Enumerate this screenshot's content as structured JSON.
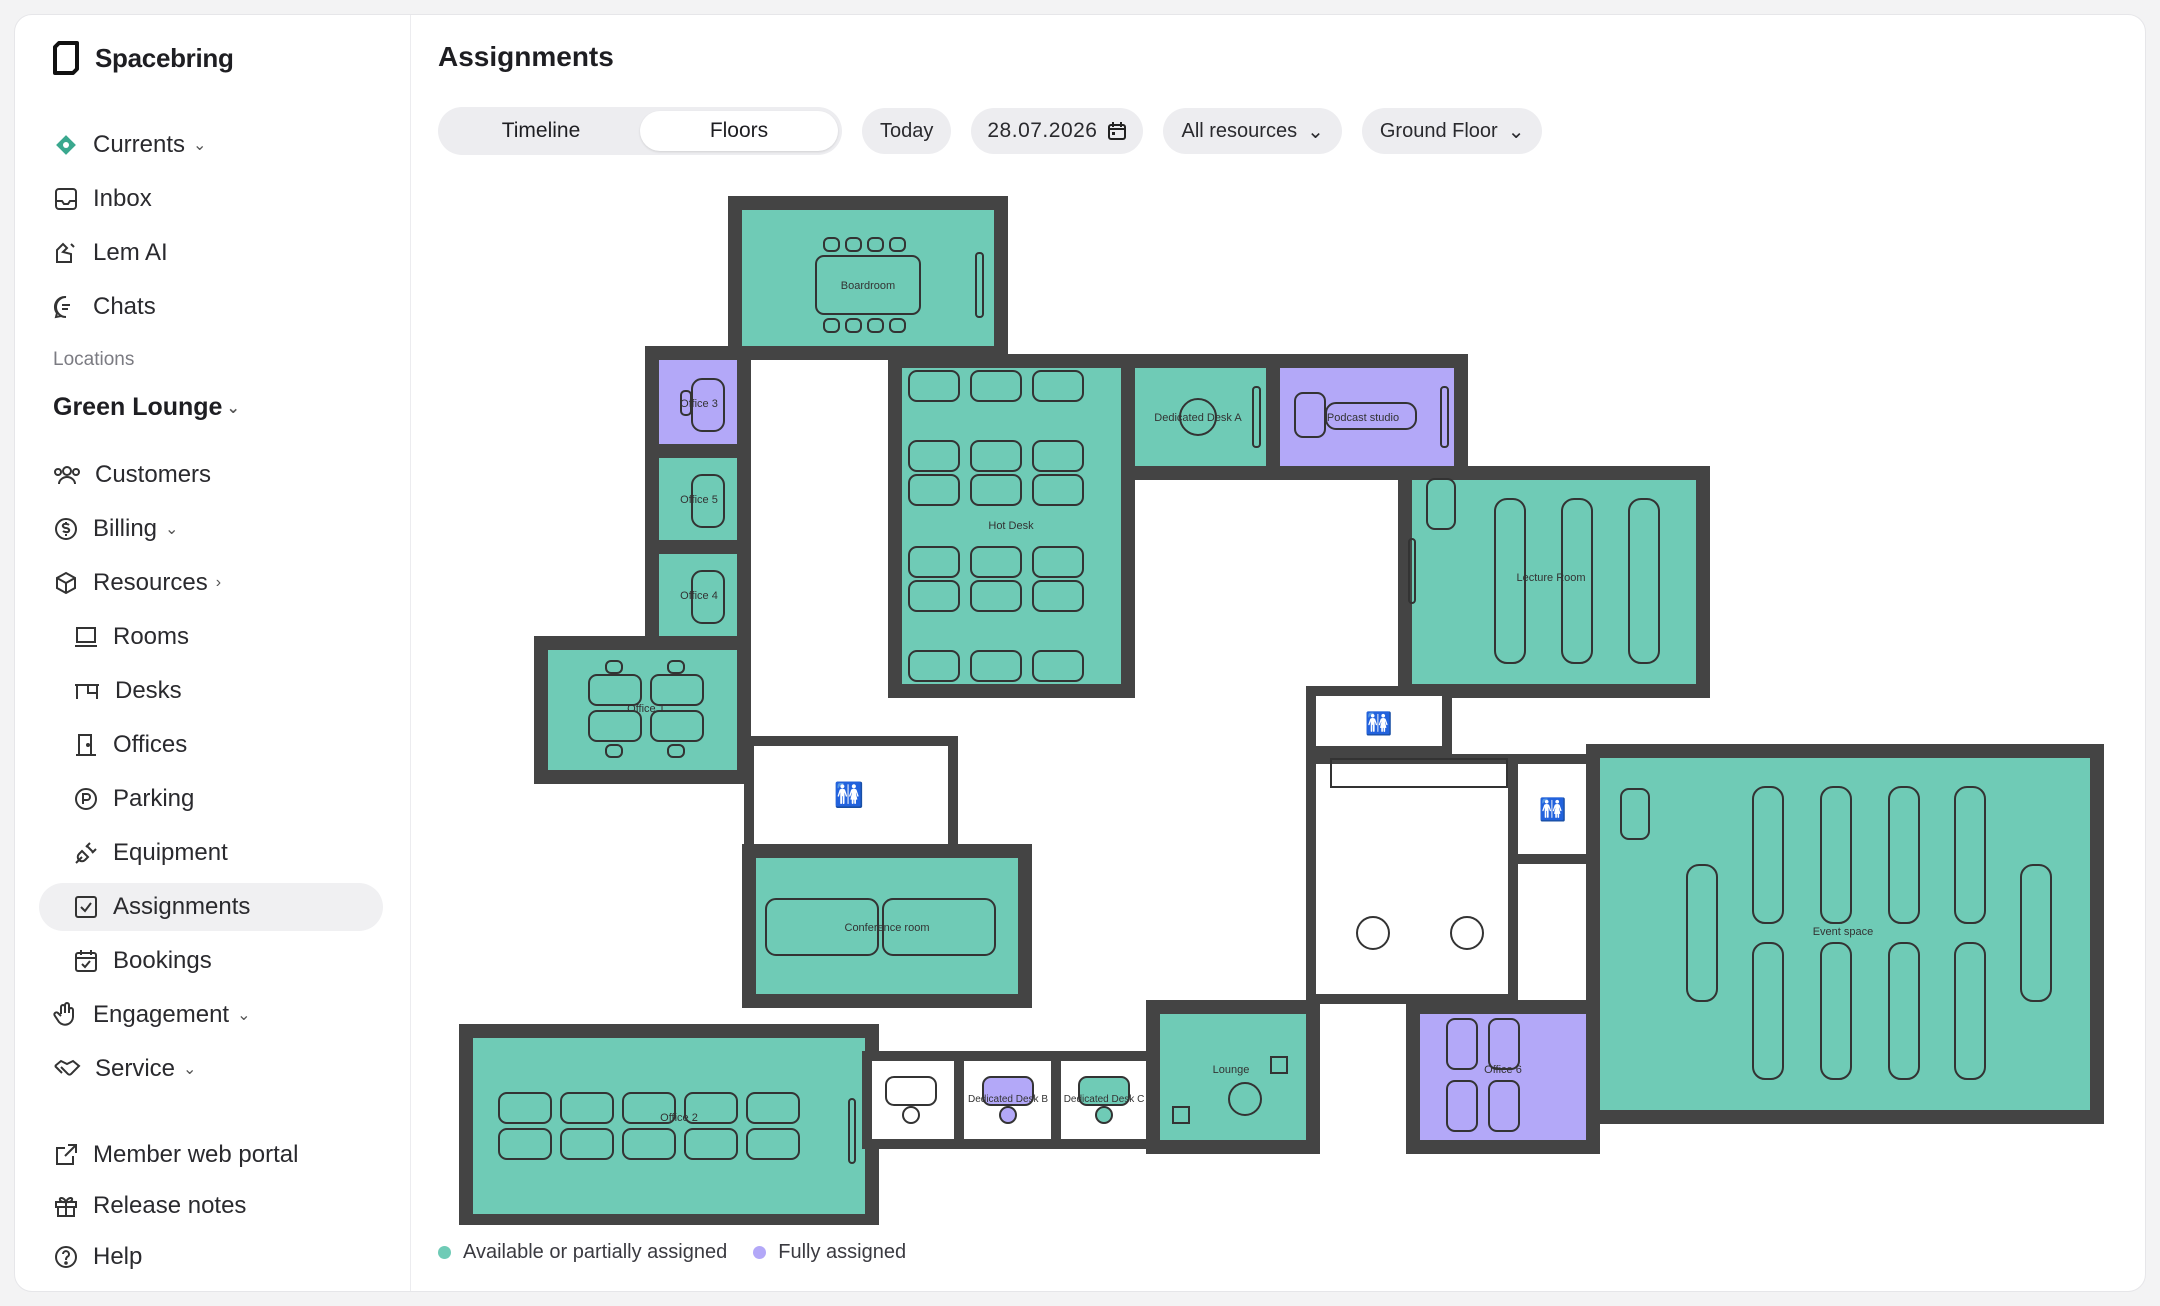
{
  "brand": {
    "name": "Spacebring"
  },
  "nav": {
    "currents": "Currents",
    "inbox": "Inbox",
    "lem_ai": "Lem AI",
    "chats": "Chats",
    "locations_label": "Locations",
    "location": "Green Lounge",
    "customers": "Customers",
    "billing": "Billing",
    "resources": "Resources",
    "rooms": "Rooms",
    "desks": "Desks",
    "offices": "Offices",
    "parking": "Parking",
    "equipment": "Equipment",
    "assignments": "Assignments",
    "bookings": "Bookings",
    "engagement": "Engagement",
    "service": "Service",
    "member_portal": "Member web portal",
    "release_notes": "Release notes",
    "help": "Help"
  },
  "page": {
    "title": "Assignments",
    "view_tabs": [
      "Timeline",
      "Floors"
    ],
    "active_tab": "Floors",
    "today": "Today",
    "date": "28.07.2026",
    "resource_filter": "All resources",
    "floor_filter": "Ground Floor"
  },
  "floorplan": {
    "rooms": {
      "boardroom": "Boardroom",
      "office3": "Office 3",
      "office5": "Office 5",
      "office4": "Office 4",
      "office1": "Office 1",
      "hotdesk": "Hot Desk",
      "dedicated_a": "Dedicated Desk A",
      "podcast": "Podcast studio",
      "lecture": "Lecture Room",
      "conference": "Conference room",
      "office2": "Office 2",
      "dedicated_b": "Dedicated Desk B",
      "dedicated_c": "Dedicated Desk C",
      "lounge": "Lounge",
      "office6": "Office 6",
      "event": "Event space"
    }
  },
  "legend": {
    "available": "Available or partially assigned",
    "full": "Fully assigned"
  },
  "colors": {
    "available": "#6fcbb6",
    "full": "#b3a8f8",
    "wall": "#444444",
    "accent": "#3aa88e"
  }
}
